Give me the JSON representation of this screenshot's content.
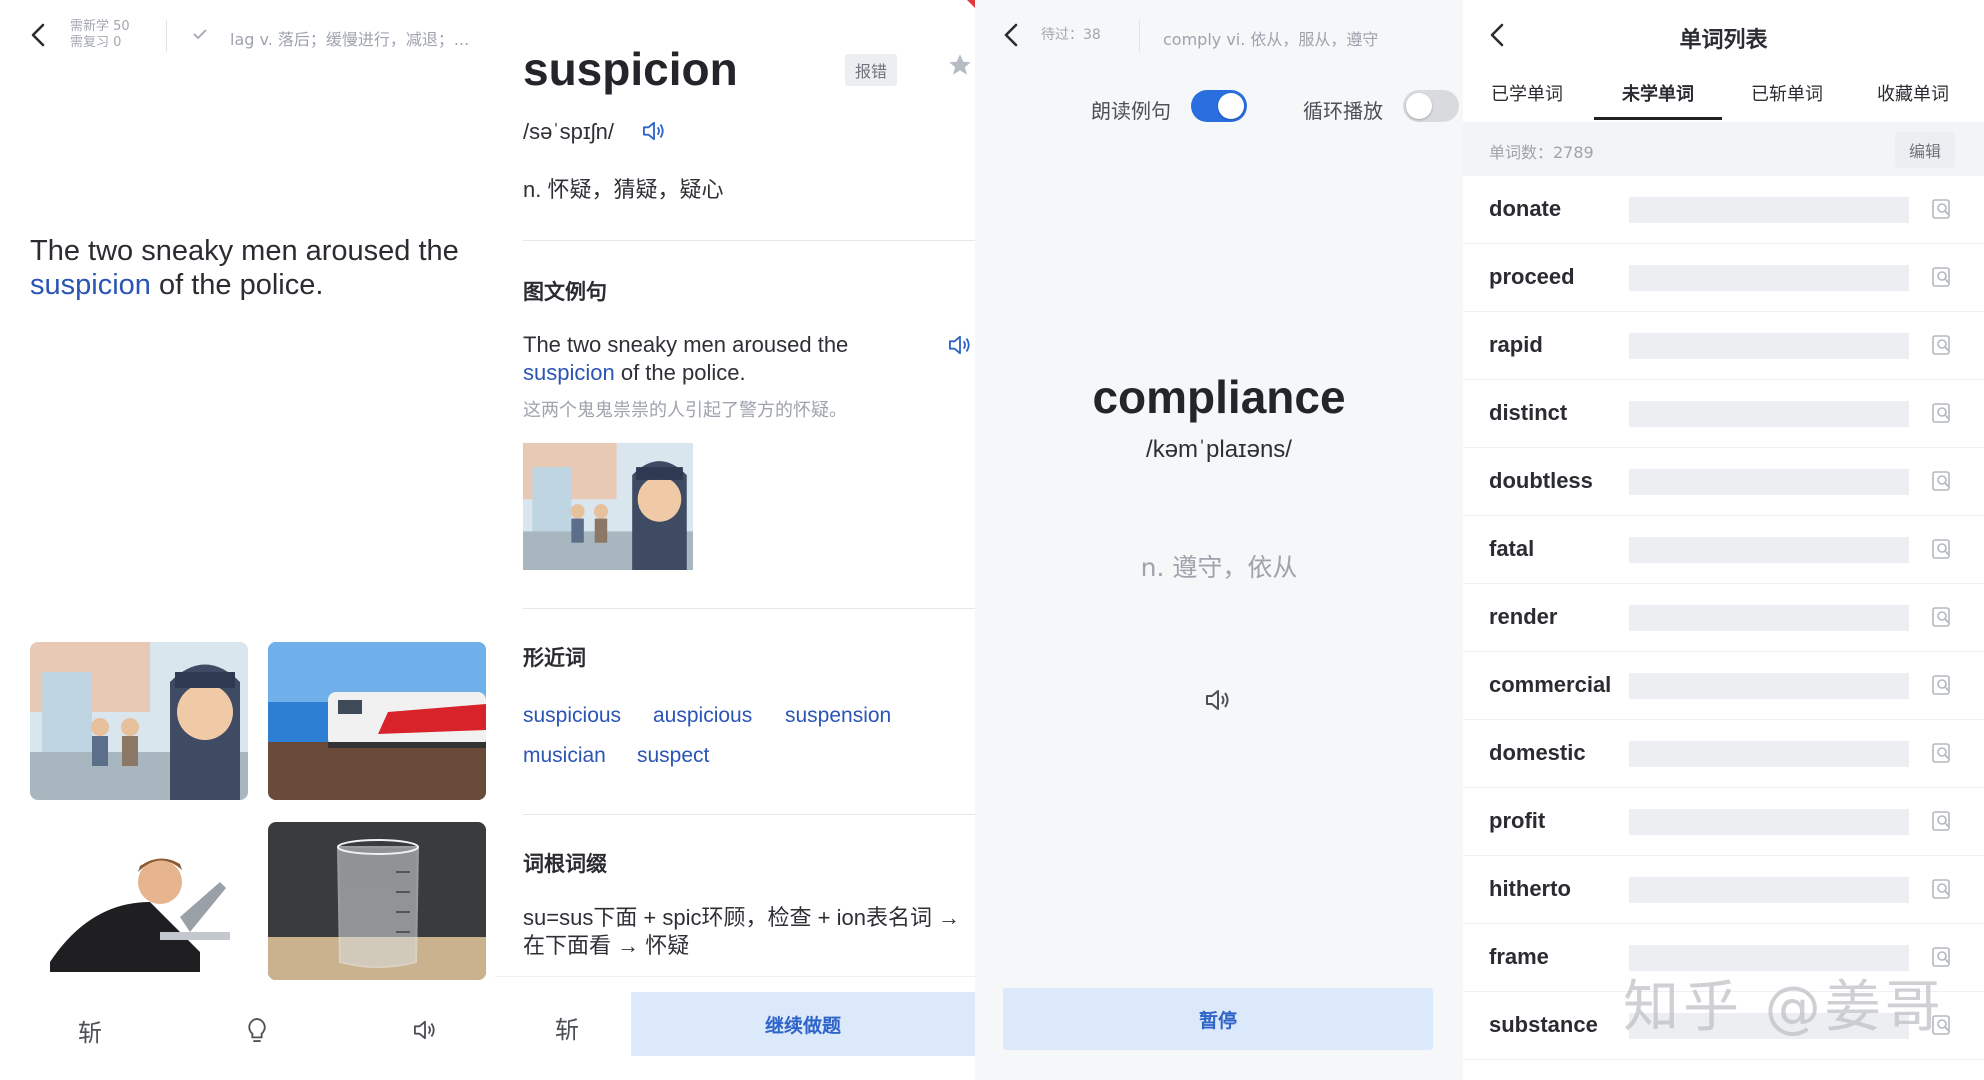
{
  "p1": {
    "stat_new": "需新学 50",
    "stat_review": "需复习 0",
    "prev_word": "lag v. 落后；缓慢进行，减退；...",
    "sentence_before": "The two sneaky men aroused the",
    "sentence_word": "suspicion",
    "sentence_after": " of the police.",
    "bottom_chop": "斩"
  },
  "p2": {
    "word": "suspicion",
    "report": "报错",
    "phonetic": "/səˈspɪʃn/",
    "meaning": "n. 怀疑，猜疑，疑心",
    "example_title": "图文例句",
    "example_before": "The two sneaky men aroused the",
    "example_word": "suspicion",
    "example_after": " of the police.",
    "example_cn": "这两个鬼鬼祟祟的人引起了警方的怀疑。",
    "similar_title": "形近词",
    "similar_words": [
      "suspicious",
      "auspicious",
      "suspension",
      "musician",
      "suspect"
    ],
    "root_title": "词根词缀",
    "root_line1": "su=sus下面 + spic环顾，检查 + ion表名词 →",
    "root_line2": "在下面看 → 怀疑",
    "chop": "斩",
    "continue": "继续做题"
  },
  "p3": {
    "pending": "待过：38",
    "prev_word": "comply vi. 依从，服从，遵守",
    "read_example_label": "朗读例句",
    "read_example_on": true,
    "loop_label": "循环播放",
    "loop_on": false,
    "word": "compliance",
    "phonetic": "/kəmˈplaɪəns/",
    "meaning": "n. 遵守，依从",
    "pause": "暂停",
    "accent": "#2a6ee0"
  },
  "p4": {
    "title": "单词列表",
    "tabs": [
      "已学单词",
      "未学单词",
      "已斩单词",
      "收藏单词"
    ],
    "active_tab": 1,
    "count_label": "单词数：2789",
    "edit": "编辑",
    "words": [
      "donate",
      "proceed",
      "rapid",
      "distinct",
      "doubtless",
      "fatal",
      "render",
      "commercial",
      "domestic",
      "profit",
      "hitherto",
      "frame",
      "substance"
    ],
    "watermark": "知乎 @姜哥"
  }
}
